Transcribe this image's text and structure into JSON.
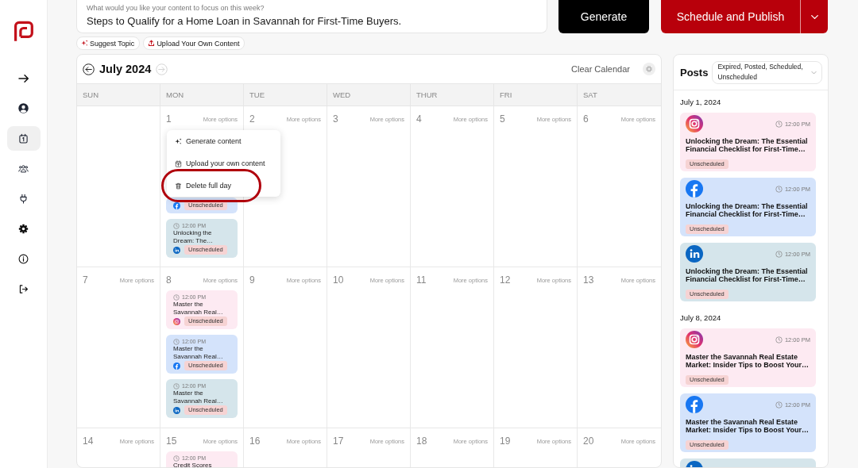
{
  "sidebar": {
    "items": [
      {
        "kind": "expand",
        "selected": false
      },
      {
        "kind": "profile",
        "selected": false
      },
      {
        "kind": "calendar",
        "selected": true
      },
      {
        "kind": "team",
        "selected": false
      },
      {
        "kind": "plug",
        "selected": false
      },
      {
        "kind": "settings",
        "selected": false
      },
      {
        "kind": "info",
        "selected": false
      },
      {
        "kind": "logout",
        "selected": false
      }
    ]
  },
  "topic_field": {
    "label": "What would you like your content to focus on this week?",
    "value": "Steps to Qualify for a Home Loan in Savannah for First-Time Buyers."
  },
  "generate_button": {
    "label": "Generate"
  },
  "publish_button": {
    "label": "Schedule and Publish"
  },
  "chips": [
    {
      "kind": "suggest",
      "label": "Suggest Topic"
    },
    {
      "kind": "upload",
      "label": "Upload Your Own Content"
    }
  ],
  "calendar": {
    "month": "July 2024",
    "prev_disabled": false,
    "next_disabled": true,
    "clear_label": "Clear Calendar",
    "weekdays": [
      "SUN",
      "MON",
      "TUE",
      "WED",
      "THUR",
      "FRI",
      "SAT"
    ],
    "weeks": [
      {
        "days": [
          {
            "kind": "blank"
          },
          {
            "kind": "day",
            "number": "1",
            "more": "More options",
            "menu": {
              "items": [
                {
                  "kind": "generate",
                  "label": "Generate content",
                  "highlighted": false
                },
                {
                  "kind": "upload",
                  "label": "Upload your own content",
                  "highlighted": false
                },
                {
                  "kind": "delete",
                  "label": "Delete full day",
                  "highlighted": true
                }
              ]
            },
            "posts": [
              {
                "kind": "facebook",
                "status": "Unscheduled"
              },
              {
                "kind": "linkedin",
                "time": "12:00 PM",
                "title": "Unlocking the Dream: The…",
                "status": "Unscheduled"
              }
            ]
          },
          {
            "kind": "day",
            "number": "2",
            "more": "More options"
          },
          {
            "kind": "day",
            "number": "3",
            "more": "More options"
          },
          {
            "kind": "day",
            "number": "4",
            "more": "More options"
          },
          {
            "kind": "day",
            "number": "5",
            "more": "More options"
          },
          {
            "kind": "day",
            "number": "6",
            "more": "More options"
          }
        ]
      },
      {
        "days": [
          {
            "kind": "day",
            "number": "7",
            "more": "More options"
          },
          {
            "kind": "day",
            "number": "8",
            "more": "More options",
            "posts": [
              {
                "kind": "instagram",
                "time": "12:00 PM",
                "title": "Master the Savannah Real…",
                "status": "Unscheduled"
              },
              {
                "kind": "facebook",
                "time": "12:00 PM",
                "title": "Master the Savannah Real…",
                "status": "Unscheduled"
              },
              {
                "kind": "linkedin",
                "time": "12:00 PM",
                "title": "Master the Savannah Real…",
                "status": "Unscheduled"
              }
            ]
          },
          {
            "kind": "day",
            "number": "9",
            "more": "More options"
          },
          {
            "kind": "day",
            "number": "10",
            "more": "More options"
          },
          {
            "kind": "day",
            "number": "11",
            "more": "More options"
          },
          {
            "kind": "day",
            "number": "12",
            "more": "More options"
          },
          {
            "kind": "day",
            "number": "13",
            "more": "More options"
          }
        ]
      },
      {
        "days": [
          {
            "kind": "day",
            "number": "14",
            "more": "More options"
          },
          {
            "kind": "day",
            "number": "15",
            "more": "More options",
            "posts": [
              {
                "kind": "instagram",
                "time": "12:00 PM",
                "title": "Credit Scores"
              }
            ]
          },
          {
            "kind": "day",
            "number": "16",
            "more": "More options"
          },
          {
            "kind": "day",
            "number": "17",
            "more": "More options"
          },
          {
            "kind": "day",
            "number": "18",
            "more": "More options"
          },
          {
            "kind": "day",
            "number": "19",
            "more": "More options"
          },
          {
            "kind": "day",
            "number": "20",
            "more": "More options"
          }
        ]
      }
    ]
  },
  "posts_panel": {
    "title": "Posts",
    "filter": "Expired, Posted, Scheduled, Unscheduled",
    "groups": [
      {
        "date": "July 1, 2024",
        "posts": [
          {
            "kind": "instagram",
            "time": "12:00 PM",
            "title": "Unlocking the Dream: The Essential Financial Checklist for First-Time…",
            "status": "Unscheduled"
          },
          {
            "kind": "facebook",
            "time": "12:00 PM",
            "title": "Unlocking the Dream: The Essential Financial Checklist for First-Time…",
            "status": "Unscheduled"
          },
          {
            "kind": "linkedin",
            "time": "12:00 PM",
            "title": "Unlocking the Dream: The Essential Financial Checklist for First-Time…",
            "status": "Unscheduled"
          }
        ]
      },
      {
        "date": "July 8, 2024",
        "posts": [
          {
            "kind": "instagram",
            "time": "12:00 PM",
            "title": "Master the Savannah Real Estate Market: Insider Tips to Boost Your…",
            "status": "Unscheduled"
          },
          {
            "kind": "facebook",
            "time": "12:00 PM",
            "title": "Master the Savannah Real Estate Market: Insider Tips to Boost Your…",
            "status": "Unscheduled"
          },
          {
            "kind": "linkedin"
          }
        ]
      }
    ]
  }
}
